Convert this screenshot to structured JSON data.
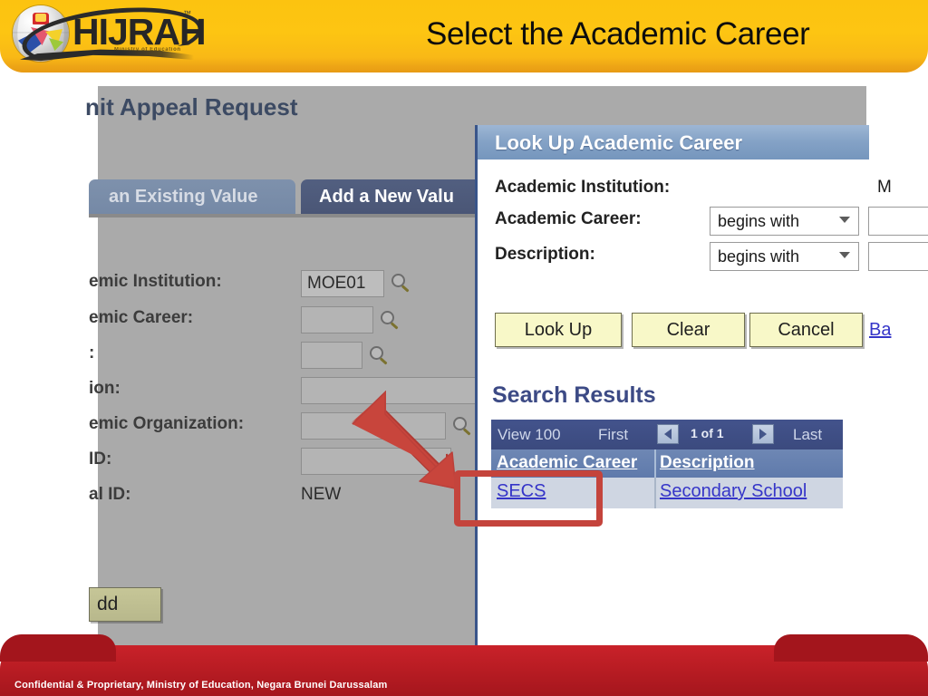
{
  "slide": {
    "title": "Select the Academic Career",
    "logo": {
      "wordmark": "HIJRAH",
      "trademark": "™",
      "tagline": "Ministry of Education"
    },
    "footer": "Confidential & Proprietary, Ministry of Education, Negara Brunei Darussalam",
    "colors": {
      "header_yellow": "#fcc310",
      "footer_red": "#bb1d24",
      "annotation_red": "#c4443c",
      "app_grey": "#aaaaaa",
      "link_blue": "#3535c8"
    }
  },
  "app": {
    "page_title": "nit Appeal Request",
    "tabs": [
      {
        "label": "an Existing Value",
        "active": false
      },
      {
        "label": "Add a New Valu",
        "active": true
      }
    ],
    "form": {
      "fields": [
        {
          "label": "emic Institution:",
          "value": "MOE01",
          "lookup": true
        },
        {
          "label": "emic Career:",
          "value": "",
          "lookup": true
        },
        {
          "label": ":",
          "value": "",
          "lookup": true
        },
        {
          "label": "ion:",
          "value": "",
          "lookup": false
        },
        {
          "label": "emic Organization:",
          "value": "",
          "lookup": true
        },
        {
          "label": " ID:",
          "value": "",
          "lookup": false
        },
        {
          "label": "al ID:",
          "value": "NEW",
          "lookup": false,
          "readonly": true
        }
      ]
    },
    "add_button": "dd"
  },
  "lookup": {
    "title": "Look Up Academic Career",
    "fields": {
      "institution": {
        "label": "Academic Institution:",
        "value": "M"
      },
      "career": {
        "label": "Academic Career:",
        "operator": "begins with",
        "value": ""
      },
      "description": {
        "label": "Description:",
        "operator": "begins with",
        "value": ""
      }
    },
    "buttons": {
      "look_up": "Look Up",
      "clear": "Clear",
      "cancel": "Cancel",
      "basic_lookup_link": "Ba"
    },
    "results": {
      "heading": "Search Results",
      "nav": {
        "view": "View 100",
        "first": "First",
        "count": "1 of 1",
        "last": "Last"
      },
      "columns": [
        "Academic Career",
        "Description"
      ],
      "rows": [
        {
          "career": "SECS",
          "description": "Secondary School"
        }
      ]
    }
  }
}
